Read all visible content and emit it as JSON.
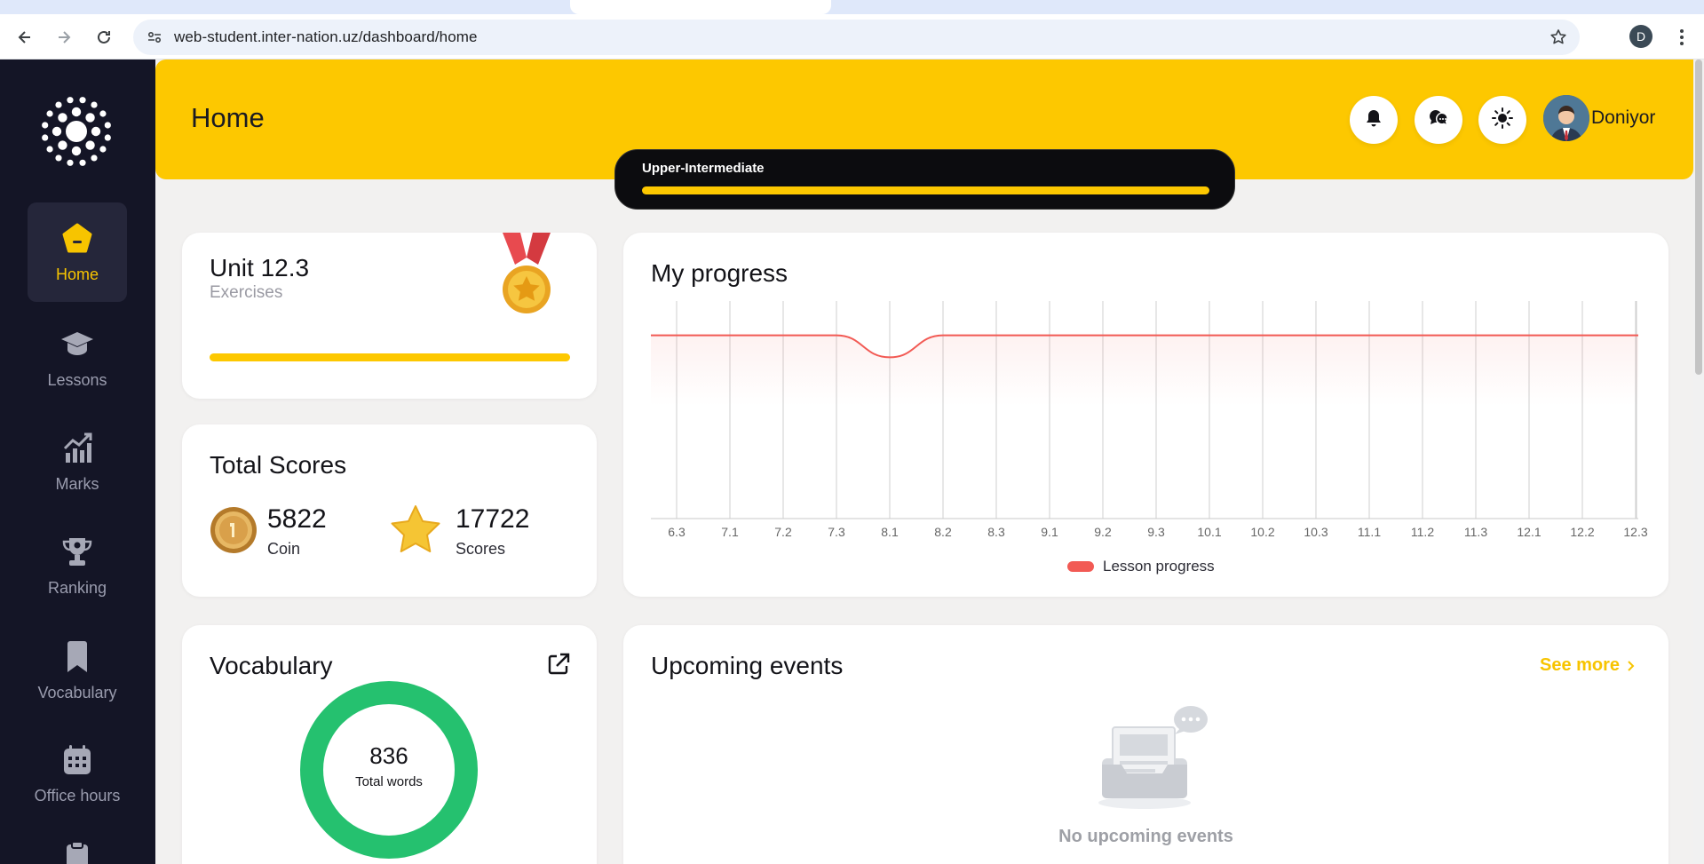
{
  "browser": {
    "url": "web-student.inter-nation.uz/dashboard/home",
    "profile_initial": "D"
  },
  "sidebar": {
    "items": [
      {
        "label": "Home",
        "icon": "home-icon",
        "active": true
      },
      {
        "label": "Lessons",
        "icon": "graduation-cap-icon"
      },
      {
        "label": "Marks",
        "icon": "chart-up-icon"
      },
      {
        "label": "Ranking",
        "icon": "trophy-icon"
      },
      {
        "label": "Vocabulary",
        "icon": "bookmark-icon"
      },
      {
        "label": "Office hours",
        "icon": "calendar-icon"
      }
    ]
  },
  "header": {
    "title": "Home",
    "user_name": "Doniyor"
  },
  "level": {
    "name": "Upper-Intermediate",
    "progress": 1.0
  },
  "unit": {
    "title": "Unit 12.3",
    "subtitle": "Exercises",
    "progress": 1.0
  },
  "scores": {
    "title": "Total Scores",
    "coin_value": "5822",
    "coin_label": "Coin",
    "score_value": "17722",
    "score_label": "Scores"
  },
  "progress_card": {
    "title": "My progress"
  },
  "chart_data": {
    "type": "line",
    "categories": [
      "6.3",
      "7.1",
      "7.2",
      "7.3",
      "8.1",
      "8.2",
      "8.3",
      "9.1",
      "9.2",
      "9.3",
      "10.1",
      "10.2",
      "10.3",
      "11.1",
      "11.2",
      "11.3",
      "12.1",
      "12.2",
      "12.3"
    ],
    "series": [
      {
        "name": "Lesson progress",
        "color": "#f25a54",
        "values": [
          100,
          100,
          100,
          100,
          88,
          100,
          100,
          100,
          100,
          100,
          100,
          100,
          100,
          100,
          100,
          100,
          100,
          100,
          100
        ]
      }
    ],
    "ylim": [
      0,
      110
    ],
    "legend": "bottom-center",
    "grid": "vertical"
  },
  "vocabulary": {
    "title": "Vocabulary",
    "total": "836",
    "total_label": "Total words"
  },
  "events": {
    "title": "Upcoming events",
    "see_more": "See more",
    "empty_text": "No upcoming events"
  }
}
